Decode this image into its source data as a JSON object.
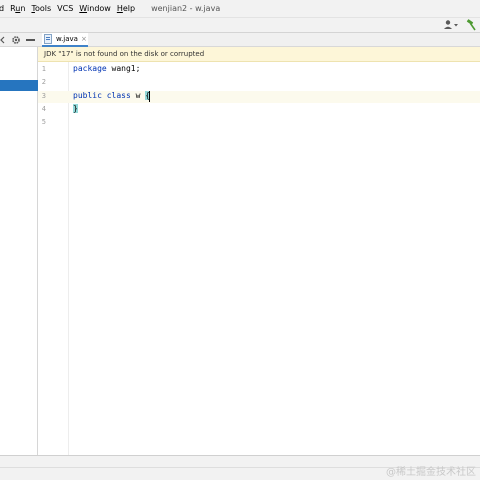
{
  "menubar": {
    "items": [
      "d",
      "Run",
      "Tools",
      "VCS",
      "Window",
      "Help"
    ],
    "mnemonics": [
      "",
      "u",
      "T",
      "",
      "W",
      "H"
    ],
    "window_title": "wenjian2 - w.java"
  },
  "toolbar": {
    "user_icon": "user-dropdown-icon",
    "build_icon": "hammer-icon",
    "build_icon_color": "#4e9a32"
  },
  "project_panel": {
    "icons": [
      "chevron-left-icon",
      "gear-icon",
      "minimize-icon"
    ],
    "selection_color": "#2675bf"
  },
  "editor": {
    "tab": {
      "label": "w.java",
      "close": "×",
      "icon": "java-file-icon"
    },
    "notification": "JDK \"17\" is not found on the disk or corrupted",
    "line_numbers": [
      "1",
      "2",
      "3",
      "4",
      "5"
    ],
    "code": {
      "line1": {
        "keyword": "package",
        "rest": " wang1;"
      },
      "line3": {
        "keyword1": "public",
        "keyword2": "class",
        "name": " w ",
        "brace": "{"
      },
      "line4": {
        "brace": "}"
      }
    },
    "keyword_color": "#0033b3",
    "brace_match_color": "#93d9d9"
  },
  "watermark": "@稀土掘金技术社区"
}
